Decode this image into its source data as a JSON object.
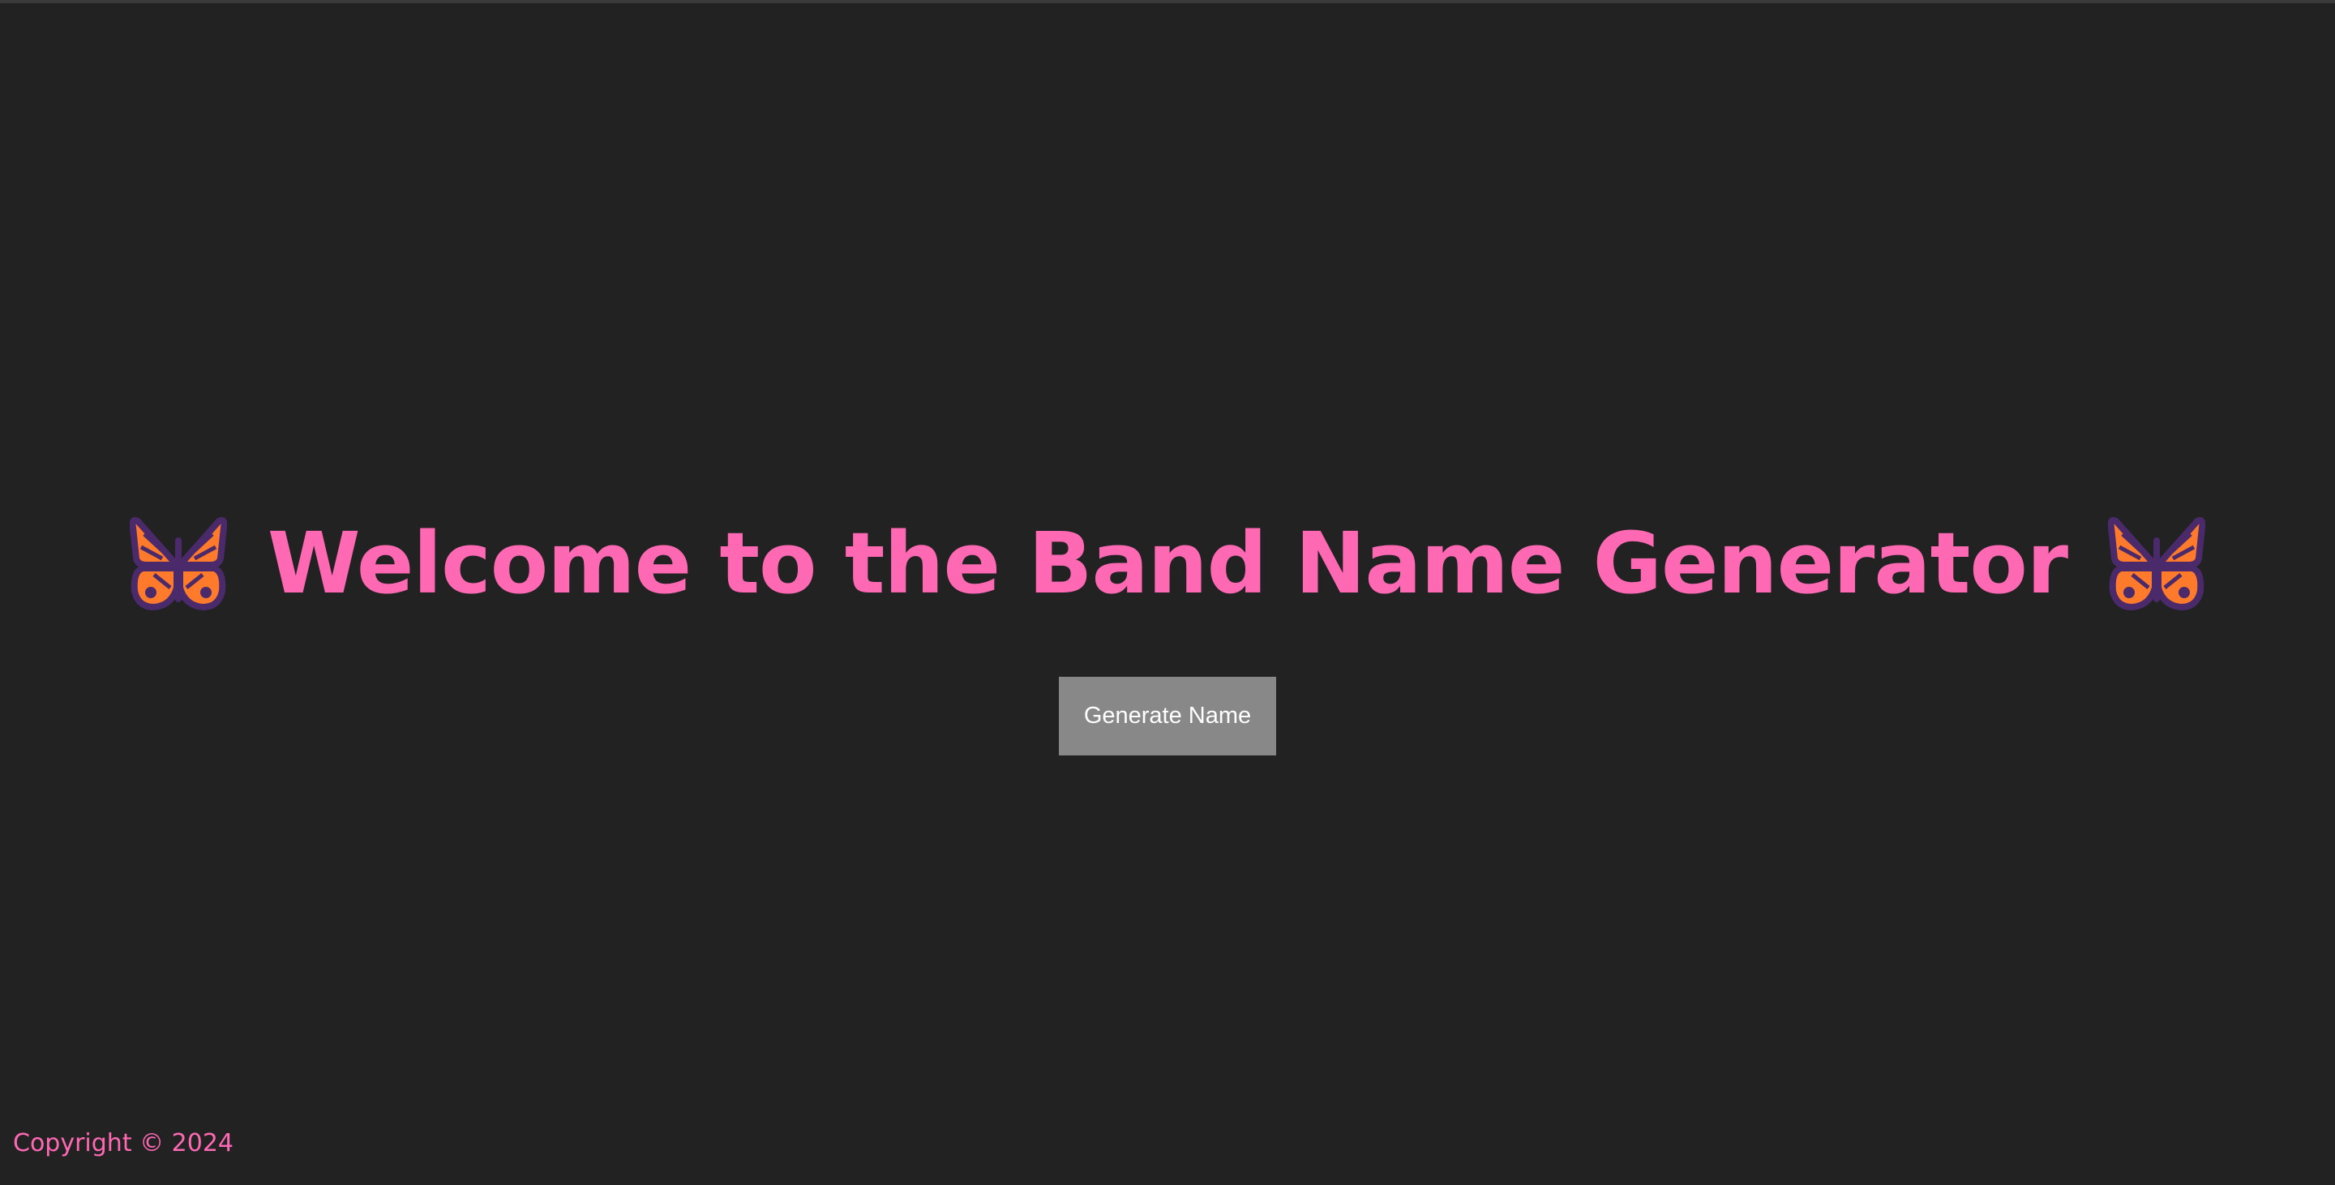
{
  "page": {
    "background_color": "#222222",
    "accent_color": "#ff69b4"
  },
  "hero": {
    "title": "Welcome to the Band Name Generator",
    "left_icon": "butterfly-icon",
    "right_icon": "butterfly-icon"
  },
  "actions": {
    "generate_label": "Generate Name",
    "button_color": "#888888"
  },
  "footer": {
    "copyright": "Copyright © 2024"
  }
}
